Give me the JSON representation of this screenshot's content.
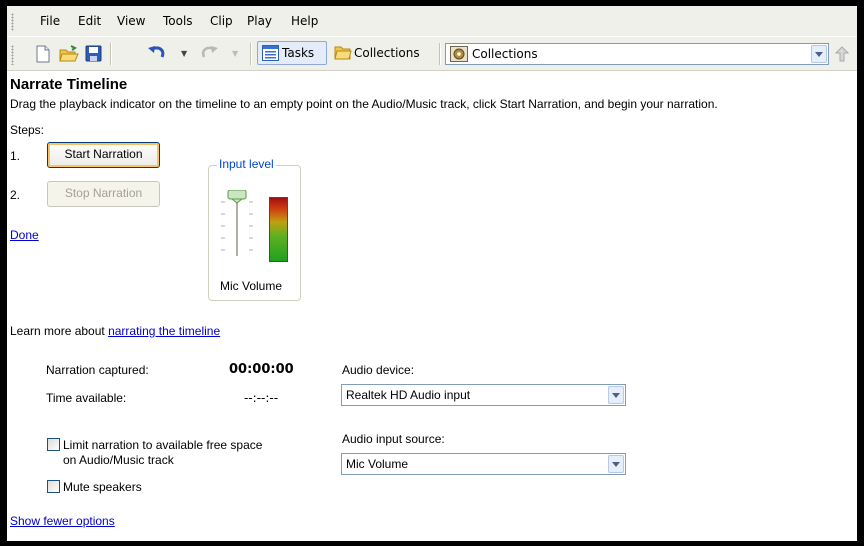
{
  "menu": [
    "File",
    "Edit",
    "View",
    "Tools",
    "Clip",
    "Play",
    "Help"
  ],
  "toolbar": {
    "tasks_label": "Tasks",
    "collections_label": "Collections",
    "collections_dropdown_value": "Collections",
    "icons": [
      "new-project-icon",
      "open-folder-icon",
      "save-icon",
      "undo-icon",
      "redo-icon",
      "tasks-icon",
      "collections-folder-icon",
      "collections-film-icon",
      "up-one-level-icon"
    ]
  },
  "panel": {
    "title": "Narrate Timeline",
    "description": "Drag the playback indicator on the timeline to an empty point on the Audio/Music track, click Start Narration, and begin your narration.",
    "steps_label": "Steps:",
    "step1_number": "1.",
    "start_button": "Start Narration",
    "step2_number": "2.",
    "stop_button": "Stop Narration",
    "done_link": "Done",
    "input_level_label": "Input level",
    "mic_volume_label": "Mic Volume",
    "learn_more_prefix": "Learn more about",
    "learn_more_link": "narrating the timeline",
    "narration_captured_label": "Narration captured:",
    "narration_captured_value": "00:00:00",
    "time_available_label": "Time available:",
    "time_available_value": "--:--:--",
    "limit_checkbox_line1": "Limit narration to available free space",
    "limit_checkbox_line2": "on Audio/Music track",
    "mute_checkbox_label": "Mute speakers",
    "show_fewer_link": "Show fewer options",
    "audio_device_label": "Audio device:",
    "audio_device_value": "Realtek HD Audio input",
    "audio_input_source_label": "Audio input source:",
    "audio_input_source_value": "Mic Volume"
  },
  "colors": {
    "link": "#0000cc",
    "legend": "#0046d5",
    "toolbar_bg": "#f0f0ea"
  }
}
